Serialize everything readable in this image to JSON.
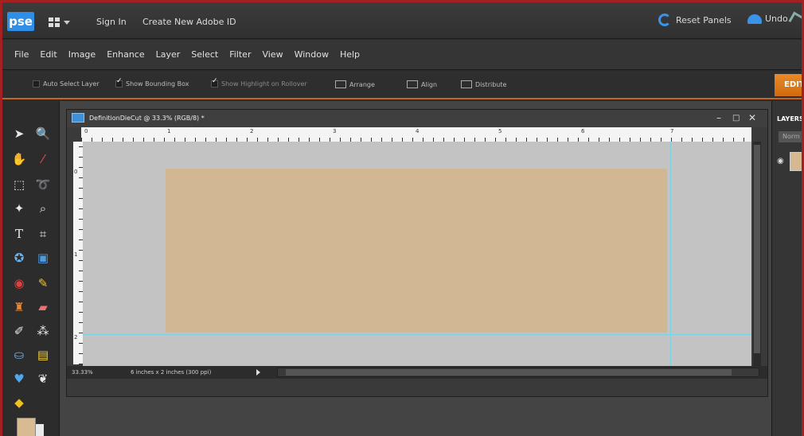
{
  "app": {
    "logo": "pse"
  },
  "topbar": {
    "sign_in": "Sign In",
    "create_id": "Create New Adobe ID",
    "reset_panels": "Reset Panels",
    "undo": "Undo"
  },
  "menu": [
    "File",
    "Edit",
    "Image",
    "Enhance",
    "Layer",
    "Select",
    "Filter",
    "View",
    "Window",
    "Help"
  ],
  "options": {
    "auto_select_layer": "Auto Select Layer",
    "show_bounding_box": "Show Bounding Box",
    "show_highlight": "Show Highlight on Rollover",
    "arrange": "Arrange",
    "align": "Align",
    "distribute": "Distribute",
    "edit_tab": "EDIT"
  },
  "document": {
    "title": "DefinitionDieCut @ 33.3% (RGB/8) *",
    "zoom": "33.33%",
    "size": "6 inches x 2 inches (300 ppi)",
    "canvas_color": "#d2b892",
    "ruler_top": [
      "0",
      "1",
      "2",
      "3",
      "4",
      "5",
      "6",
      "7"
    ],
    "ruler_left": [
      "0",
      "1",
      "2"
    ]
  },
  "panel": {
    "layers_label": "LAYERS",
    "blend_mode": "Norm"
  },
  "colors": {
    "accent": "#c9661d",
    "brand_blue": "#2f8fe6",
    "foreground_swatch": "#d8bb91"
  }
}
